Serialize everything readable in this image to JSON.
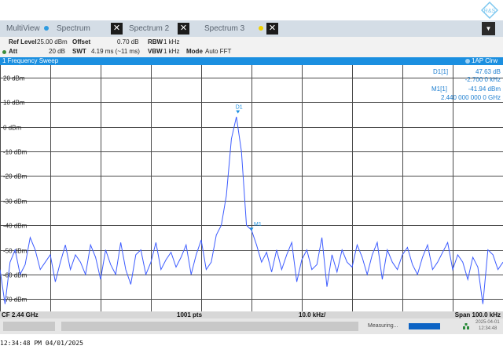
{
  "tabs": {
    "multiview": "MultiView",
    "spectrum": "Spectrum",
    "spectrum2": "Spectrum 2",
    "spectrum3": "Spectrum 3",
    "close": "✕",
    "dropdown": "▼"
  },
  "params": {
    "ref_level_label": "Ref Level",
    "ref_level_value": "25.00 dBm",
    "offset_label": "Offset",
    "offset_value": "0.70 dB",
    "rbw_label": "RBW",
    "rbw_value": "1 kHz",
    "att_label": "Att",
    "att_value": "20 dB",
    "swt_label": "SWT",
    "swt_value": "4.19 ms (~11 ms)",
    "vbw_label": "VBW",
    "vbw_value": "1 kHz",
    "mode_label": "Mode",
    "mode_value": "Auto FFT"
  },
  "window": {
    "title": "1 Frequency Sweep",
    "trace": "1AP Clrw"
  },
  "markers": {
    "d1_label": "D1[1]",
    "d1_value1": "47.63 dB",
    "d1_value2": "-2.700 0 kHz",
    "m1_label": "M1[1]",
    "m1_value1": "-41.94 dBm",
    "m1_value2": "2.440 000 000 0 GHz",
    "d1_tag": "D1",
    "m1_tag": "M1"
  },
  "status": {
    "cf": "CF 2.44 GHz",
    "pts": "1001 pts",
    "div": "10.0 kHz/",
    "span": "Span 100.0 kHz"
  },
  "bottom": {
    "measuring": "Measuring...",
    "date": "2025-04-01",
    "time": "12:34:48"
  },
  "timestamp": "12:34:48  PM  04/01/2025",
  "colors": {
    "trace": "#3d5cff",
    "accent": "#1b8fe0",
    "marker_text": "#1e7fd0"
  },
  "chart_data": {
    "type": "line",
    "xlabel": "",
    "ylabel": "",
    "y_ticks": [
      "20 dBm",
      "10 dBm",
      "0 dBm",
      "-10 dBm",
      "-20 dBm",
      "-30 dBm",
      "-40 dBm",
      "-50 dBm",
      "-60 dBm",
      "-70 dBm"
    ],
    "ylim": [
      -75,
      25
    ],
    "xlim": [
      -50,
      50
    ],
    "x_unit": "kHz offset from CF",
    "grid": true,
    "series": [
      {
        "x": [
          -50,
          -49,
          -48,
          -47,
          -46,
          -45,
          -44,
          -43,
          -42,
          -41,
          -40,
          -39,
          -38,
          -37,
          -36,
          -35,
          -34,
          -33,
          -32,
          -31,
          -30,
          -29,
          -28,
          -27,
          -26,
          -25,
          -24,
          -23,
          -22,
          -21,
          -20,
          -19,
          -18,
          -17,
          -16,
          -15,
          -14,
          -13,
          -12,
          -11,
          -10,
          -9,
          -8,
          -7,
          -6,
          -5,
          -4,
          -3,
          -2,
          -1,
          0,
          1,
          2,
          3,
          4,
          5,
          6,
          7,
          8,
          9,
          10,
          11,
          12,
          13,
          14,
          15,
          16,
          17,
          18,
          19,
          20,
          21,
          22,
          23,
          24,
          25,
          26,
          27,
          28,
          29,
          30,
          31,
          32,
          33,
          34,
          35,
          36,
          37,
          38,
          39,
          40,
          41,
          42,
          43,
          44,
          45,
          46,
          47,
          48,
          49,
          50
        ],
        "y": [
          -58,
          -72,
          -55,
          -50,
          -60,
          -56,
          -45,
          -50,
          -58,
          -55,
          -52,
          -63,
          -55,
          -48,
          -58,
          -52,
          -55,
          -60,
          -48,
          -53,
          -62,
          -50,
          -56,
          -60,
          -47,
          -58,
          -64,
          -52,
          -50,
          -60,
          -55,
          -47,
          -58,
          -54,
          -51,
          -57,
          -53,
          -48,
          -60,
          -52,
          -46,
          -58,
          -55,
          -44,
          -40,
          -28,
          -5,
          4,
          -10,
          -40,
          -42,
          -48,
          -55,
          -51,
          -59,
          -50,
          -58,
          -52,
          -47,
          -63,
          -54,
          -50,
          -58,
          -56,
          -45,
          -65,
          -52,
          -59,
          -50,
          -55,
          -57,
          -48,
          -53,
          -60,
          -52,
          -47,
          -62,
          -50,
          -55,
          -58,
          -52,
          -49,
          -56,
          -60,
          -53,
          -48,
          -58,
          -55,
          -51,
          -47,
          -58,
          -52,
          -55,
          -62,
          -53,
          -57,
          -72,
          -50,
          -52,
          -58,
          -55
        ]
      }
    ],
    "markers": [
      {
        "name": "D1",
        "x": -2.7,
        "y": 5.69
      },
      {
        "name": "M1",
        "x": 0,
        "y": -41.94
      }
    ]
  }
}
